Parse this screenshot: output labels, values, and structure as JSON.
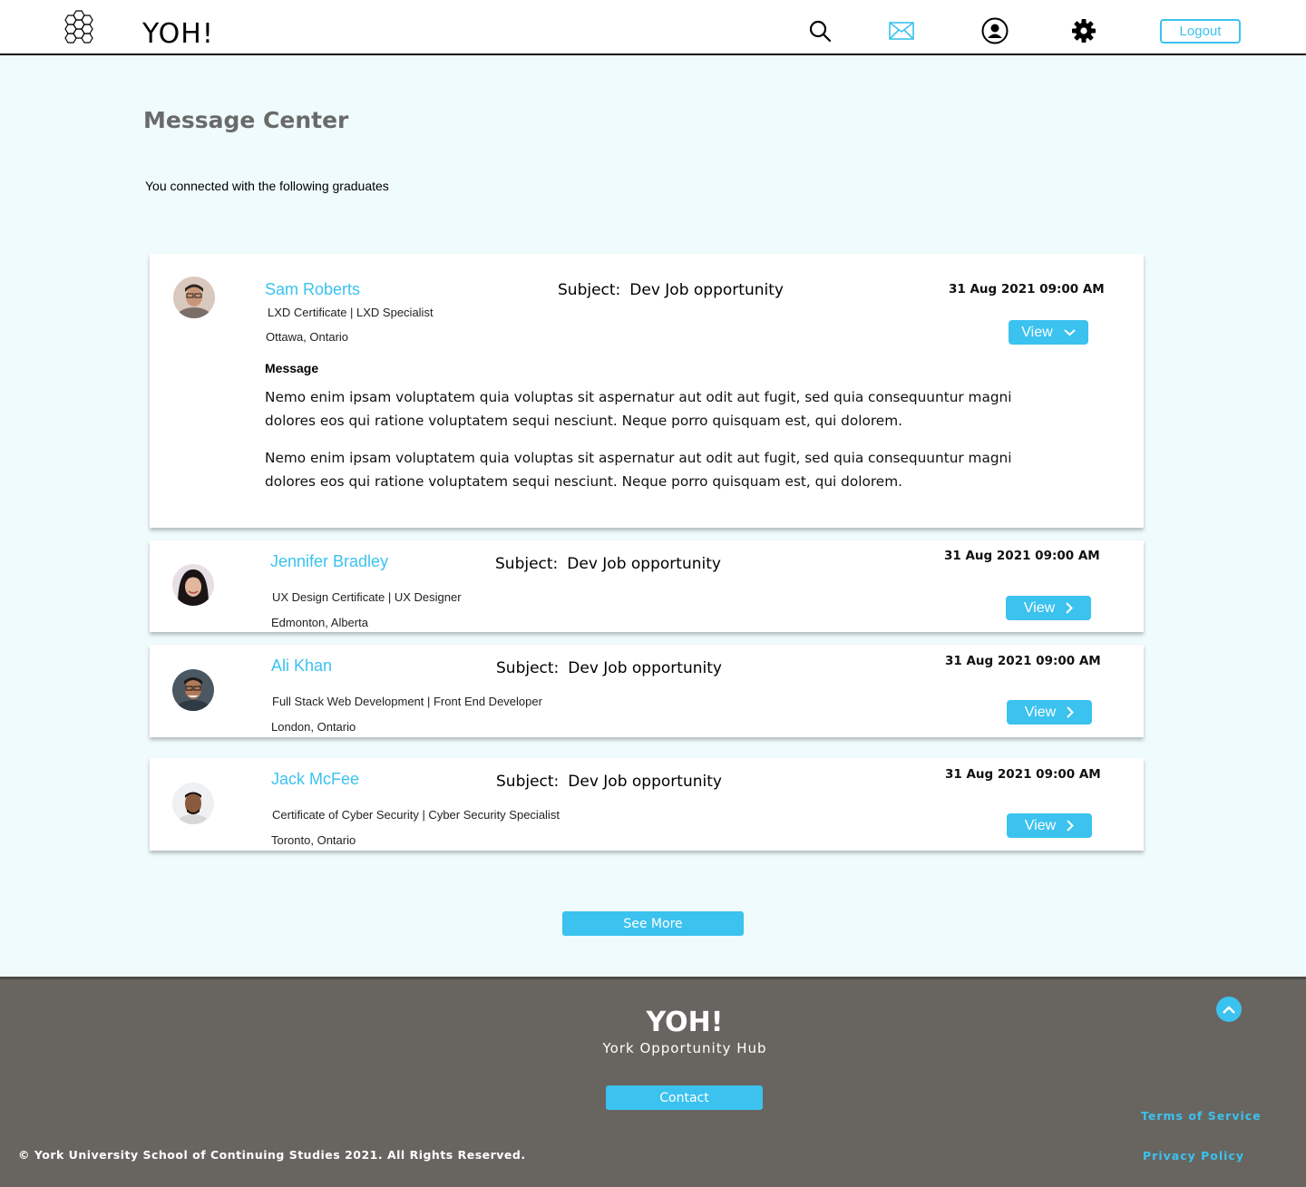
{
  "header": {
    "brand": "YOH!",
    "icons": [
      "honeycomb-logo-icon",
      "search-icon",
      "mail-icon",
      "user-icon",
      "gear-icon"
    ],
    "logout_label": "Logout",
    "active_icon_color": "#3bc2ef"
  },
  "main": {
    "title": "Message Center",
    "intro": "You connected with the following graduates",
    "messages": [
      {
        "name": "Sam Roberts",
        "credentials": "LXD Certificate | LXD Specialist",
        "location": "Ottawa, Ontario",
        "subject_label": "Subject:",
        "subject": "Dev Job opportunity",
        "date": "31 Aug 2021 09:00 AM",
        "view_label": "View",
        "expanded": true,
        "message_heading": "Message",
        "message_paragraphs": [
          "Nemo enim ipsam voluptatem quia voluptas sit aspernatur aut odit aut fugit, sed quia consequuntur magni dolores eos qui ratione voluptatem sequi nesciunt. Neque porro quisquam est, qui dolorem.",
          "Nemo enim ipsam voluptatem quia voluptas sit aspernatur aut odit aut fugit, sed quia consequuntur magni dolores eos qui ratione voluptatem sequi nesciunt. Neque porro quisquam est, qui dolorem."
        ]
      },
      {
        "name": "Jennifer Bradley",
        "credentials": "UX Design Certificate | UX Designer",
        "location": "Edmonton, Alberta",
        "subject_label": "Subject:",
        "subject": "Dev Job opportunity",
        "date": "31 Aug 2021 09:00 AM",
        "view_label": "View",
        "expanded": false
      },
      {
        "name": "Ali Khan",
        "credentials": "Full Stack Web Development | Front End Developer",
        "location": "London, Ontario",
        "subject_label": "Subject:",
        "subject": "Dev Job opportunity",
        "date": "31 Aug 2021 09:00 AM",
        "view_label": "View",
        "expanded": false
      },
      {
        "name": "Jack McFee",
        "credentials": "Certificate of Cyber Security | Cyber Security Specialist",
        "location": "Toronto, Ontario",
        "subject_label": "Subject:",
        "subject": "Dev Job opportunity",
        "date": "31 Aug 2021 09:00 AM",
        "view_label": "View",
        "expanded": false
      }
    ],
    "see_more_label": "See More"
  },
  "footer": {
    "brand": "YOH!",
    "tagline": "York Opportunity Hub",
    "contact_label": "Contact",
    "terms_label": "Terms of Service",
    "privacy_label": "Privacy Policy",
    "copyright": "© York University School of Continuing Studies 2021. All Rights Reserved."
  },
  "colors": {
    "accent": "#3bc2ef",
    "page_bg": "#effbfc",
    "footer_bg": "#686460",
    "title_gray": "#6a6a6a"
  }
}
